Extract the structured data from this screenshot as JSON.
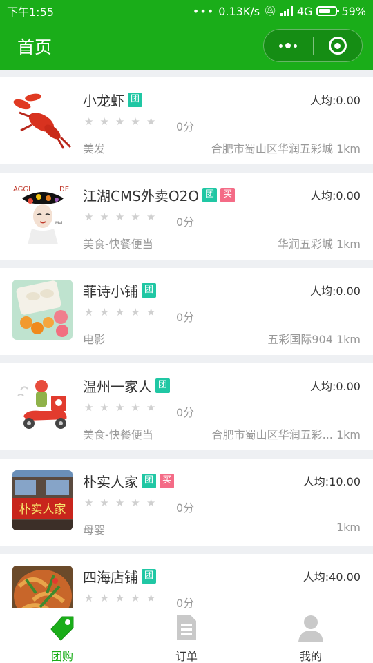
{
  "status_bar": {
    "time": "下午1:55",
    "net_speed": "0.13K/s",
    "network": "4G",
    "battery": "59%"
  },
  "nav": {
    "title": "首页",
    "menu_icon": "more-dots-icon",
    "close_icon": "target-circle-icon"
  },
  "shops": [
    {
      "name": "小龙虾",
      "tags": [
        "团"
      ],
      "avg_price": "人均:0.00",
      "rating": 0,
      "score": "0分",
      "category": "美发",
      "address": "合肥市蜀山区华润五彩城",
      "distance": "1km",
      "image": "crayfish-thumbnail"
    },
    {
      "name": "江湖CMS外卖O2O",
      "tags": [
        "团",
        "买"
      ],
      "avg_price": "人均:0.00",
      "rating": 0,
      "score": "0分",
      "category": "美食-快餐便当",
      "address": "华润五彩城",
      "distance": "1km",
      "image": "fashion-model-thumbnail"
    },
    {
      "name": "菲诗小铺",
      "tags": [
        "团"
      ],
      "avg_price": "人均:0.00",
      "rating": 0,
      "score": "0分",
      "category": "电影",
      "address": "五彩国际904",
      "distance": "1km",
      "image": "fruit-dessert-thumbnail"
    },
    {
      "name": "温州一家人",
      "tags": [
        "团"
      ],
      "avg_price": "人均:0.00",
      "rating": 0,
      "score": "0分",
      "category": "美食-快餐便当",
      "address": "合肥市蜀山区华润五彩...",
      "distance": "1km",
      "image": "delivery-scooter-thumbnail"
    },
    {
      "name": "朴实人家",
      "tags": [
        "团",
        "买"
      ],
      "avg_price": "人均:10.00",
      "rating": 0,
      "score": "0分",
      "category": "母婴",
      "address": "",
      "distance": "1km",
      "image": "restaurant-storefront-thumbnail",
      "sign_text": "朴实人家"
    },
    {
      "name": "四海店铺",
      "tags": [
        "团"
      ],
      "avg_price": "人均:40.00",
      "rating": 0,
      "score": "0分",
      "category": "",
      "address": "",
      "distance": "",
      "image": "seafood-dish-thumbnail"
    }
  ],
  "tabs": [
    {
      "label": "团购",
      "icon": "tag-icon",
      "active": true
    },
    {
      "label": "订单",
      "icon": "document-icon",
      "active": false
    },
    {
      "label": "我的",
      "icon": "user-icon",
      "active": false
    }
  ],
  "colors": {
    "brand_green": "#1aad19",
    "tag_tuan": "#20c7a4",
    "tag_mai": "#f46b86",
    "star_empty": "#d0d0d0"
  }
}
